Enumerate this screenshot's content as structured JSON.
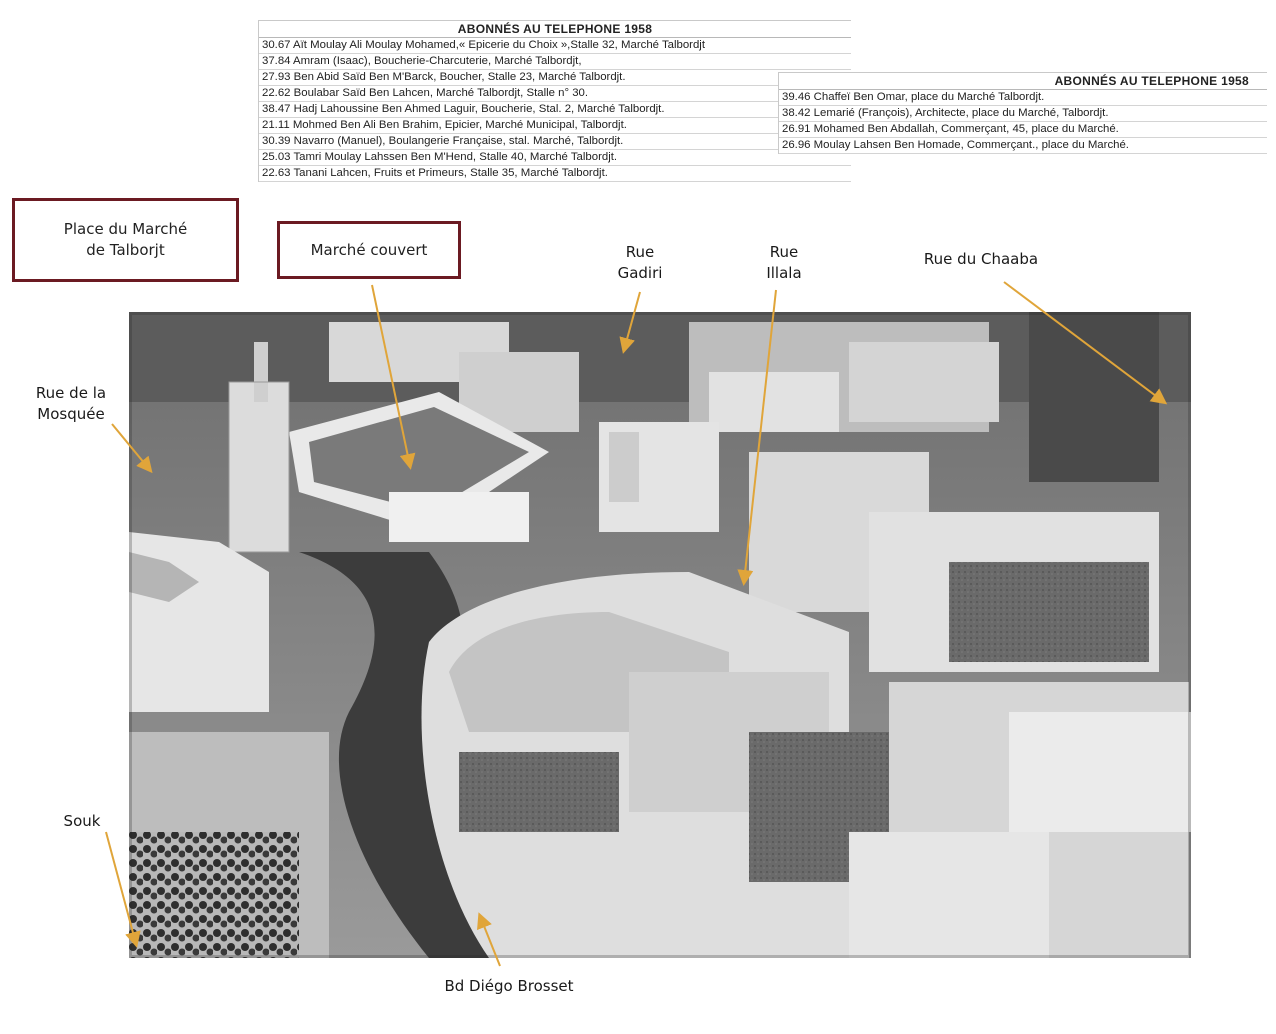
{
  "directory_left": {
    "title": "ABONNÉS AU TELEPHONE 1958",
    "rows": [
      "30.67 Aït Moulay Ali Moulay Mohamed,« Epicerie du Choix »,Stalle 32, Marché Talbordjt",
      "37.84 Amram (Isaac), Boucherie-Charcuterie, Marché Talbordjt,",
      "27.93 Ben Abid Saïd Ben M'Barck, Boucher, Stalle 23, Marché Talbordjt.",
      "22.62 Boulabar Saïd Ben Lahcen, Marché Talbordjt, Stalle n° 30.",
      "38.47 Hadj Lahoussine Ben Ahmed Laguir, Boucherie, Stal. 2, Marché Talbordjt.",
      "21.11 Mohmed Ben Ali Ben Brahim, Epicier, Marché Municipal, Talbordjt.",
      "30.39 Navarro (Manuel), Boulangerie Française, stal. Marché, Talbordjt.",
      "25.03 Tamri Moulay Lahssen Ben M'Hend, Stalle 40, Marché Talbordjt.",
      "22.63 Tanani Lahcen, Fruits et Primeurs, Stalle 35, Marché Talbordjt."
    ]
  },
  "directory_right": {
    "title": "ABONNÉS AU TELEPHONE 1958",
    "rows": [
      "39.46 Chaffeï Ben Omar, place du Marché Talbordjt.",
      "38.42 Lemarié (François), Architecte, place du Marché, Talbordjt.",
      "26.91 Mohamed Ben Abdallah, Commerçant, 45, place du Marché.",
      "26.96 Moulay Lahsen Ben Homade, Commerçant., place du Marché."
    ]
  },
  "labels": {
    "place_line1": "Place du Marché",
    "place_line2": "de Talborjt",
    "marche_couvert": "Marché couvert",
    "rue_gadiri_1": "Rue",
    "rue_gadiri_2": "Gadiri",
    "rue_illala_1": "Rue",
    "rue_illala_2": "Illala",
    "rue_chaaba": "Rue du Chaaba",
    "rue_mosquee_1": "Rue de la",
    "rue_mosquee_2": "Mosquée",
    "souk": "Souk",
    "bd_diego": "Bd Diégo Brosset"
  },
  "colors": {
    "arrow": "#e0a53a",
    "box_border": "#6b1a22"
  }
}
